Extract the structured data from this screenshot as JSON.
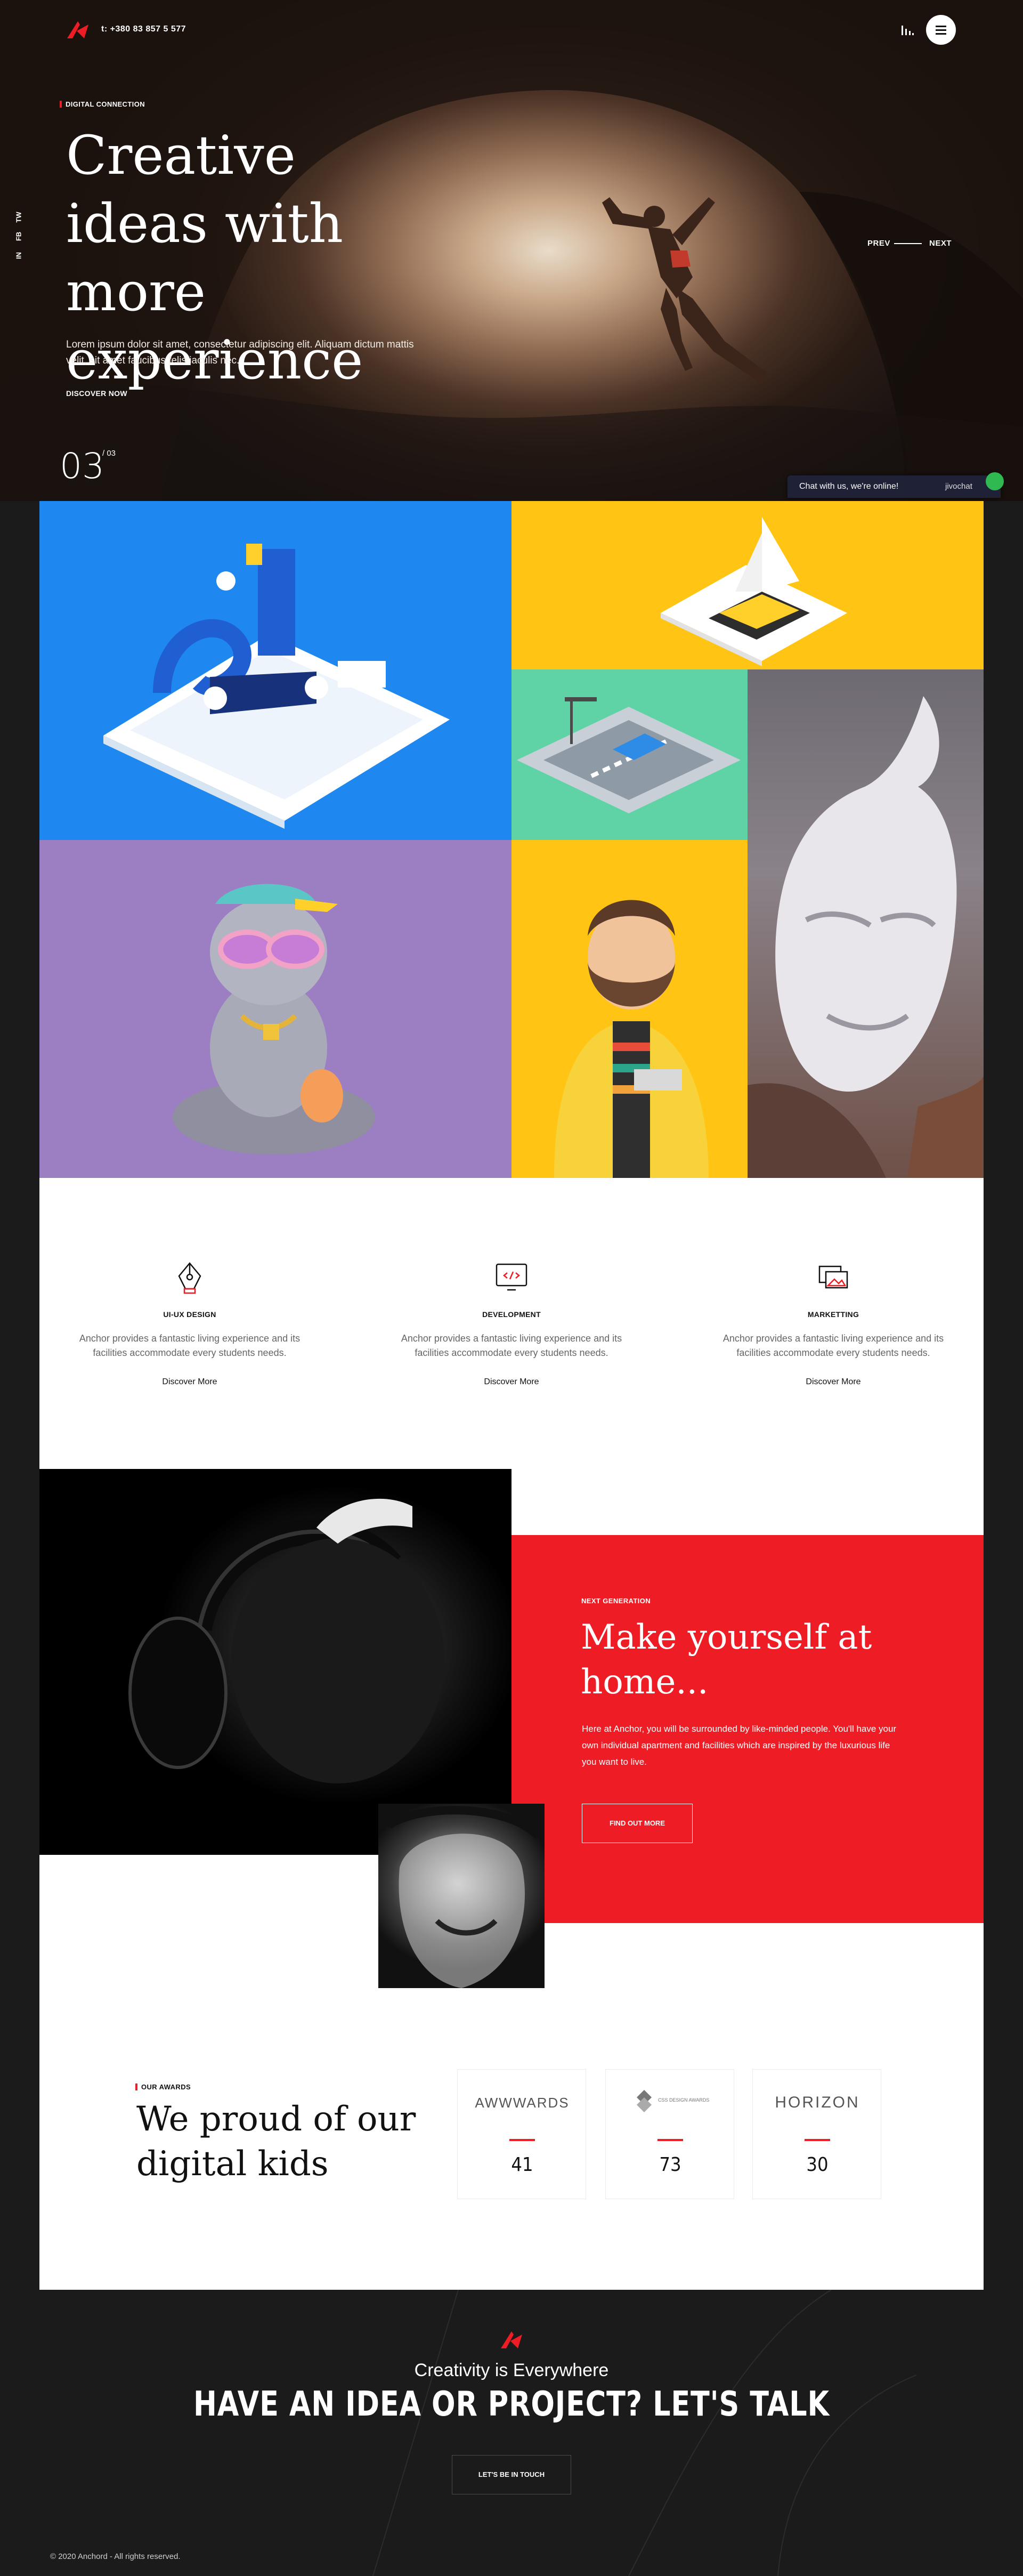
{
  "header": {
    "phone": "t: +380 83 857 5 577",
    "menu_icon": "hamburger-icon"
  },
  "hero": {
    "eyebrow": "DIGITAL CONNECTION",
    "title": "Creative ideas with more experience",
    "text": "Lorem ipsum dolor sit amet, consectetur adipiscing elit. Aliquam dictum mattis velit, sit amet faucibus felis iaculis nec.",
    "cta": "DISCOVER NOW",
    "counter_current": "03",
    "counter_total": "/ 03",
    "nav_prev": "PREV",
    "nav_next": "NEXT",
    "social": [
      "TW",
      "FB",
      "IN"
    ]
  },
  "chat": {
    "text": "Chat with us, we're online!",
    "brand": "jivochat"
  },
  "services": [
    {
      "title": "UI-UX DESIGN",
      "text": "Anchor provides a fantastic living experience and its facilities accommodate every students needs.",
      "link": "Discover More",
      "icon": "pen-tool-icon"
    },
    {
      "title": "DEVELOPMENT",
      "text": "Anchor provides a fantastic living experience and its facilities accommodate every students needs.",
      "link": "Discover More",
      "icon": "code-monitor-icon"
    },
    {
      "title": "MARKETTING",
      "text": "Anchor provides a fantastic living experience and its facilities accommodate every students needs.",
      "link": "Discover More",
      "icon": "gallery-icon"
    }
  ],
  "next_generation": {
    "eyebrow": "NEXT GENERATION",
    "title": "Make yourself at home...",
    "text": "Here at Anchor, you will be surrounded by like-minded people. You'll have your own individual apartment and facilities which are inspired by the luxurious life you want to live.",
    "button": "FIND OUT MORE"
  },
  "awards": {
    "eyebrow": "OUR AWARDS",
    "title": "We proud of our digital kids",
    "items": [
      {
        "logo": "AWWWARDS",
        "count": "41"
      },
      {
        "logo": "CSS DESIGN AWARDS",
        "count": "73"
      },
      {
        "logo": "HORIZON",
        "count": "30"
      }
    ]
  },
  "footer": {
    "subtitle": "Creativity is Everywhere",
    "title": "HAVE AN IDEA OR PROJECT? LET'S TALK",
    "button": "LET'S BE IN TOUCH",
    "copyright": "© 2020 Anchord - All rights reserved."
  },
  "colors": {
    "accent": "#ee1c25",
    "dark": "#1b1b1b",
    "blue": "#1e88f0",
    "yellow": "#ffc414",
    "mint": "#5fd3a6",
    "purple": "#9c7fc2",
    "gray": "#6e6a72"
  }
}
